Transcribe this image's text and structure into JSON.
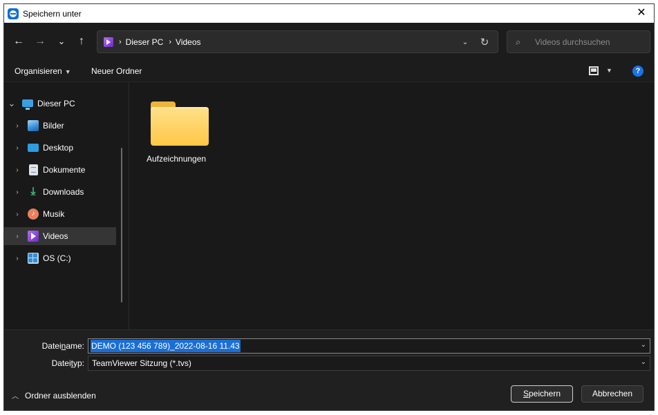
{
  "titlebar": {
    "title": "Speichern unter",
    "close": "✕"
  },
  "nav": {
    "back": "←",
    "forward": "→",
    "recent": "⌄",
    "up": "↑",
    "breadcrumb": [
      "Dieser PC",
      "Videos"
    ],
    "separator": "›",
    "dropdown": "⌄",
    "refresh": "↻",
    "search_icon": "⌕",
    "search_placeholder": "Videos durchsuchen"
  },
  "cmdbar": {
    "organize": "Organisieren",
    "new_folder": "Neuer Ordner",
    "caret": "▼",
    "help": "?"
  },
  "sidebar": {
    "items": [
      {
        "label": "Dieser PC",
        "icon": "pc-icon",
        "chevron": "⌄",
        "selected": false
      },
      {
        "label": "Bilder",
        "icon": "pictures-icon",
        "chevron": "›",
        "selected": false
      },
      {
        "label": "Desktop",
        "icon": "desktop-icon",
        "chevron": "›",
        "selected": false
      },
      {
        "label": "Dokumente",
        "icon": "documents-icon",
        "chevron": "›",
        "selected": false
      },
      {
        "label": "Downloads",
        "icon": "download-icon",
        "chevron": "›",
        "selected": false
      },
      {
        "label": "Musik",
        "icon": "music-icon",
        "chevron": "›",
        "selected": false
      },
      {
        "label": "Videos",
        "icon": "video-icon",
        "chevron": "›",
        "selected": true
      },
      {
        "label": "OS (C:)",
        "icon": "drive-icon",
        "chevron": "›",
        "selected": false
      }
    ]
  },
  "content": {
    "folders": [
      {
        "name": "Aufzeichnungen",
        "icon": "folder-icon"
      }
    ]
  },
  "bottom": {
    "filename_label_pre": "Datei",
    "filename_label_u": "n",
    "filename_label_post": "ame:",
    "filename_value": "DEMO (123 456 789)_2022-08-16 11.43",
    "filetype_label_pre": "Datei",
    "filetype_label_u": "t",
    "filetype_label_post": "yp:",
    "filetype_value": "TeamViewer Sitzung (*.tvs)",
    "box_caret": "⌄",
    "hide_folders": "Ordner ausblenden",
    "hide_caret": "︿",
    "save_u": "S",
    "save_rest": "peichern",
    "cancel": "Abbrechen"
  },
  "colors": {
    "accent": "#1a6fd6",
    "background": "#191919",
    "selected_row": "#353535",
    "folder": "#ffc845"
  }
}
